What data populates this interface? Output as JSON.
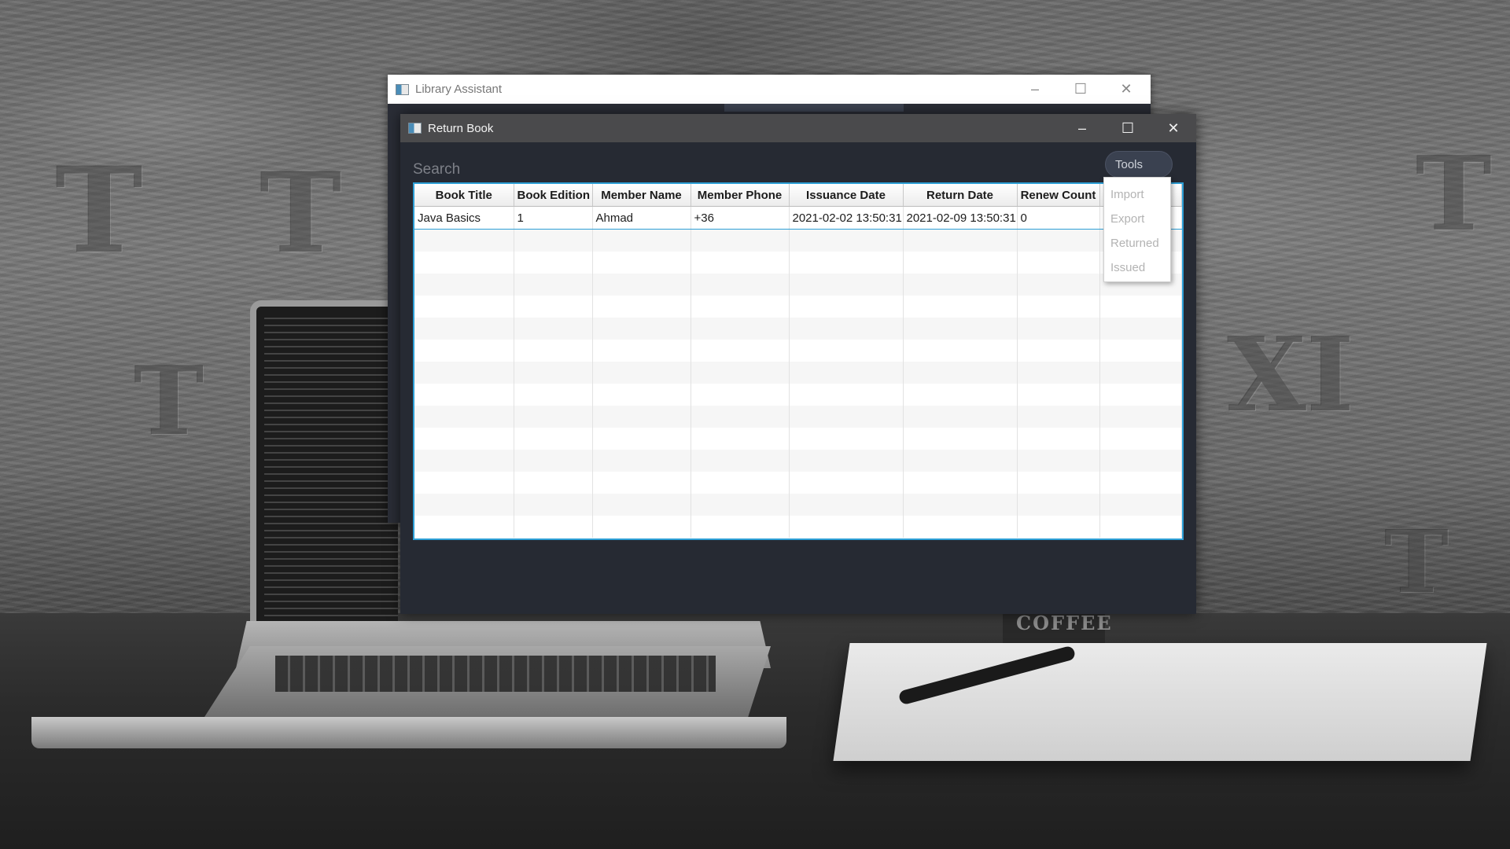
{
  "back_window": {
    "title": "Library Assistant",
    "controls": {
      "minimize": "–",
      "maximize": "☐",
      "close": "✕"
    }
  },
  "front_window": {
    "title": "Return Book",
    "controls": {
      "minimize": "–",
      "maximize": "☐",
      "close": "✕"
    },
    "search": {
      "placeholder": "Search",
      "value": ""
    },
    "tools_button": {
      "label": "Tools"
    },
    "tools_menu": {
      "items": [
        "Import",
        "Export",
        "Returned",
        "Issued"
      ]
    },
    "table": {
      "columns": [
        "Book Title",
        "Book Edition",
        "Member Name",
        "Member Phone",
        "Issuance Date",
        "Return Date",
        "Renew Count"
      ],
      "rows": [
        [
          "Java Basics",
          "1",
          "Ahmad",
          "+36",
          "2021-02-02 13:50:31",
          "2021-02-09 13:50:31",
          "0"
        ]
      ],
      "selected_row": 0
    }
  },
  "background": {
    "mug_label": "COFFEE"
  },
  "colors": {
    "window_bg": "#262a33",
    "titlebar_front": "#4a4a4c",
    "accent": "#2d9fd6",
    "menu_text_disabled": "#b3b3b3"
  },
  "icons": {
    "window_icon": "app-window-icon"
  }
}
